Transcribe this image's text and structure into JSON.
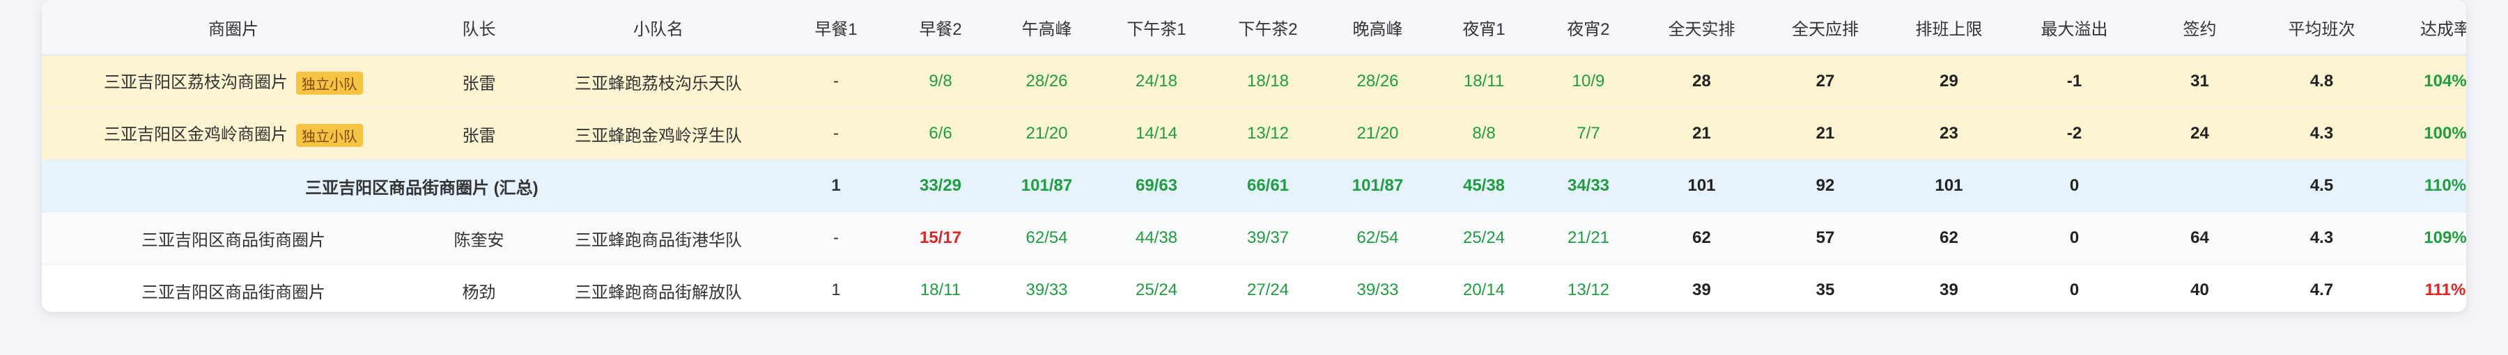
{
  "columns": [
    "商圈片",
    "队长",
    "小队名",
    "早餐1",
    "早餐2",
    "午高峰",
    "下午茶1",
    "下午茶2",
    "晚高峰",
    "夜宵1",
    "夜宵2",
    "全天实排",
    "全天应排",
    "排班上限",
    "最大溢出",
    "签约",
    "平均班次",
    "达成率"
  ],
  "badge_label": "独立小队",
  "rows": [
    {
      "type": "indep",
      "area": "三亚吉阳区荔枝沟商圈片",
      "badge": true,
      "captain": "张雷",
      "team": "三亚蜂跑荔枝沟乐天队",
      "b1": "-",
      "b2": "9/8",
      "lunch": "28/26",
      "tea1": "24/18",
      "tea2": "18/18",
      "dinner": "28/26",
      "night1": "18/11",
      "night2": "10/9",
      "actual": "28",
      "required": "27",
      "limit": "29",
      "overflow": "-1",
      "signed": "31",
      "avg": "4.8",
      "rate": "104%"
    },
    {
      "type": "indep",
      "area": "三亚吉阳区金鸡岭商圈片",
      "badge": true,
      "captain": "张雷",
      "team": "三亚蜂跑金鸡岭浮生队",
      "b1": "-",
      "b2": "6/6",
      "lunch": "21/20",
      "tea1": "14/14",
      "tea2": "13/12",
      "dinner": "21/20",
      "night1": "8/8",
      "night2": "7/7",
      "actual": "21",
      "required": "21",
      "limit": "23",
      "overflow": "-2",
      "signed": "24",
      "avg": "4.3",
      "rate": "100%"
    },
    {
      "type": "sum",
      "area": "三亚吉阳区商品街商圈片 (汇总)",
      "badge": false,
      "captain": "",
      "team": "",
      "b1": "1",
      "b2": "33/29",
      "lunch": "101/87",
      "tea1": "69/63",
      "tea2": "66/61",
      "dinner": "101/87",
      "night1": "45/38",
      "night2": "34/33",
      "actual": "101",
      "required": "92",
      "limit": "101",
      "overflow": "0",
      "signed": "",
      "avg": "4.5",
      "rate": "110%"
    },
    {
      "type": "alt",
      "area": "三亚吉阳区商品街商圈片",
      "badge": false,
      "captain": "陈奎安",
      "team": "三亚蜂跑商品街港华队",
      "b1": "-",
      "b2": "15/17",
      "lunch": "62/54",
      "tea1": "44/38",
      "tea2": "39/37",
      "dinner": "62/54",
      "night1": "25/24",
      "night2": "21/21",
      "actual": "62",
      "required": "57",
      "limit": "62",
      "overflow": "0",
      "signed": "64",
      "avg": "4.3",
      "rate": "109%"
    },
    {
      "type": "plain",
      "area": "三亚吉阳区商品街商圈片",
      "badge": false,
      "captain": "杨劲",
      "team": "三亚蜂跑商品街解放队",
      "b1": "1",
      "b2": "18/11",
      "lunch": "39/33",
      "tea1": "25/24",
      "tea2": "27/24",
      "dinner": "39/33",
      "night1": "20/14",
      "night2": "13/12",
      "actual": "39",
      "required": "35",
      "limit": "39",
      "overflow": "0",
      "signed": "40",
      "avg": "4.7",
      "rate": "111%"
    }
  ],
  "colors": {
    "good": "#1e9e3e",
    "bad": "#e02424",
    "indep_bg": "#fdf4d1",
    "sum_bg": "#e6f3fc",
    "badge_bg": "#f6c343"
  }
}
